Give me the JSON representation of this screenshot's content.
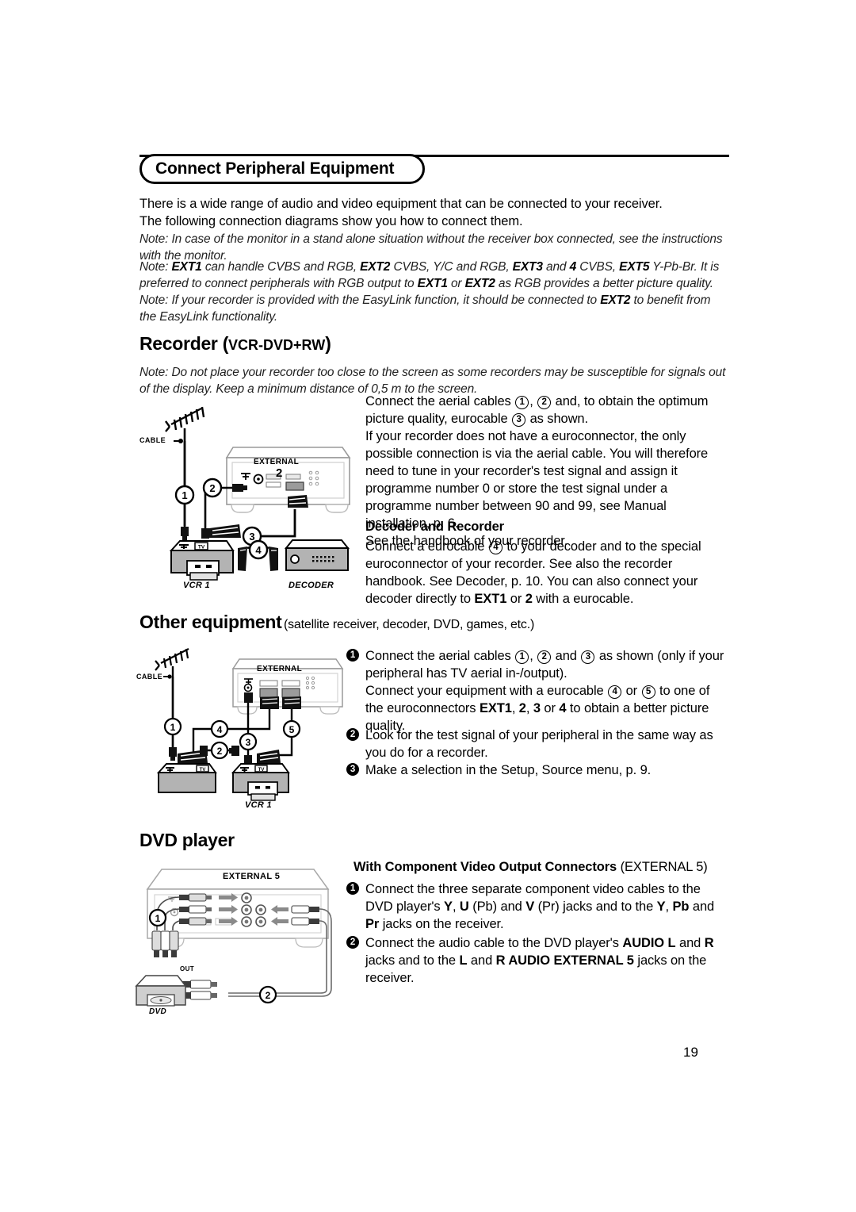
{
  "header": {
    "title": "Connect Peripheral Equipment"
  },
  "intro": {
    "line1": "There is a wide range of audio and video equipment that can be connected to your receiver.",
    "line2": "The following connection diagrams show you how to connect them."
  },
  "notes": {
    "note1_label": "Note:",
    "note1_text": "In case of the monitor in a stand alone situation without the receiver box connected, see the instructions with the monitor.",
    "note2_label": "Note:",
    "note2_parts": {
      "a": "EXT1",
      "b": " can handle CVBS and RGB, ",
      "c": "EXT2",
      "d": " CVBS, Y/C and RGB, ",
      "e": "EXT3",
      "f": " and ",
      "g": "4",
      "h": " CVBS, ",
      "i": "EXT5",
      "j": " Y-Pb-Br. It is preferred to connect peripherals with RGB output to ",
      "k": "EXT1",
      "l": " or ",
      "m": "EXT2",
      "n": " as RGB provides a better picture quality."
    },
    "note3_label": "Note:",
    "note3_parts": {
      "a": "If your recorder is provided with the EasyLink function, it should be connected to ",
      "b": "EXT2",
      "c": " to benefit from the EasyLink functionality."
    }
  },
  "recorder": {
    "heading_main": "Recorder",
    "heading_paren_open": "(",
    "heading_caps": "VCR-DVD+RW",
    "heading_paren_close": ")",
    "note_label": "Note:",
    "note_text": "Do not place your recorder too close to the screen as some recorders may be susceptible for signals out of the display. Keep a minimum distance of 0,5 m to the screen.",
    "text": {
      "p1_a": "Connect the aerial cables ",
      "p1_n1": "1",
      "p1_b": ", ",
      "p1_n2": "2",
      "p1_c": " and, to obtain the optimum picture quality, eurocable ",
      "p1_n3": "3",
      "p1_d": " as shown.",
      "p2": "If your recorder does not have a euroconnector, the only possible connection is via the aerial cable. You will therefore need to tune in your recorder's test signal and assign it programme number 0 or store the test signal under a programme number between 90 and 99, see Manual installation, p. 6.",
      "p3": "See the handbook of your recorder."
    },
    "decoder_heading": "Decoder and Recorder",
    "decoder_text": {
      "a": "Connect a eurocable ",
      "n4": "4",
      "b": " to your decoder and to the special euroconnector of your recorder. See also the recorder handbook. See Decoder, p. 10. You can also connect your decoder directly to ",
      "c": "EXT1",
      "d": " or ",
      "e": "2",
      "f": " with a eurocable."
    },
    "diagram_labels": {
      "cable": "CABLE",
      "external": "EXTERNAL",
      "external_num": "2",
      "vcr": "VCR 1",
      "decoder": "DECODER",
      "n1": "1",
      "n2": "2",
      "n3": "3",
      "n4": "4",
      "tv": "TV"
    }
  },
  "other_equipment": {
    "heading": "Other equipment",
    "heading_sub": "(satellite receiver, decoder, DVD, games, etc.)",
    "items": [
      {
        "num": "1",
        "parts": {
          "a": "Connect the aerial cables ",
          "n1": "1",
          "b": ", ",
          "n2": "2",
          "c": " and ",
          "n3": "3",
          "d": " as shown (only if your peripheral has TV aerial in-/output).",
          "e": "Connect your equipment with a eurocable ",
          "n4": "4",
          "f": " or ",
          "n5": "5",
          "g": " to one of the euroconnectors ",
          "h": "EXT1",
          "i": ", ",
          "j": "2",
          "k": ",  ",
          "l": "3",
          "m": " or ",
          "n": "4",
          "o": " to obtain a better picture quality."
        }
      },
      {
        "num": "2",
        "text": "Look for the test signal of your peripheral in the same way as you do for a recorder."
      },
      {
        "num": "3",
        "text": "Make a selection in the Setup, Source menu, p. 9."
      }
    ],
    "diagram_labels": {
      "cable": "CABLE",
      "external": "EXTERNAL",
      "vcr": "VCR 1",
      "n1": "1",
      "n2": "2",
      "n3": "3",
      "n4": "4",
      "n5": "5",
      "tv": "TV"
    }
  },
  "dvd": {
    "heading": "DVD player",
    "sub_heading_bold": "With Component Video Output Connectors",
    "sub_heading_reg": " (EXTERNAL 5)",
    "items": [
      {
        "num": "1",
        "parts": {
          "a": "Connect the three separate component video cables to the DVD player's ",
          "b": "Y",
          "c": ", ",
          "d": "U",
          "e": " (Pb) and ",
          "f": "V",
          "g": " (Pr) jacks and to the ",
          "h": "Y",
          "i": ", ",
          "j": "Pb",
          "k": " and ",
          "l": "Pr",
          "m": " jacks on the receiver."
        }
      },
      {
        "num": "2",
        "parts": {
          "a": "Connect the audio cable to the DVD player's ",
          "b": "AUDIO L",
          "c": " and ",
          "d": "R",
          "e": " jacks and to the ",
          "f": "L",
          "g": " and ",
          "h": "R AUDIO EXTERNAL 5",
          "i": " jacks on the receiver."
        }
      }
    ],
    "diagram_labels": {
      "external5": "EXTERNAL 5",
      "out": "OUT",
      "dvd": "DVD",
      "n1": "1",
      "n2": "2"
    }
  },
  "page_number": "19"
}
